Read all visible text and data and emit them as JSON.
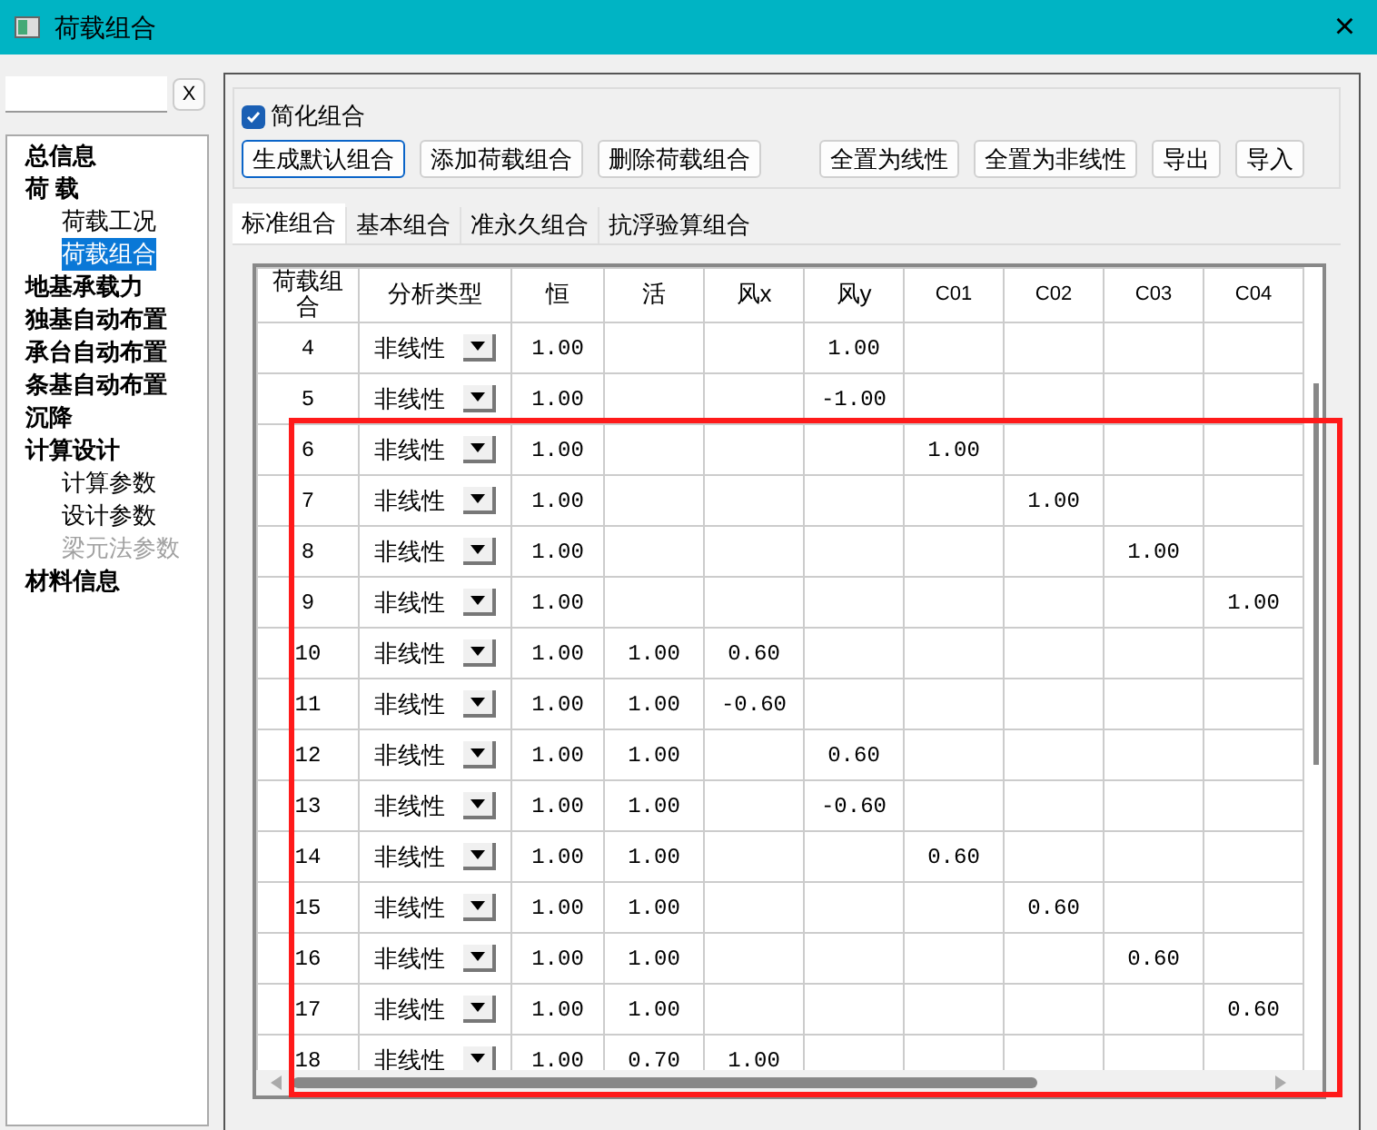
{
  "window": {
    "title": "荷载组合",
    "close": "×"
  },
  "search": {
    "clear": "X"
  },
  "tree": [
    {
      "label": "总信息",
      "disabled": false,
      "selected": false
    },
    {
      "label": "荷 载",
      "disabled": false,
      "selected": false,
      "children": [
        {
          "label": "荷载工况",
          "disabled": false,
          "selected": false
        },
        {
          "label": "荷载组合",
          "disabled": false,
          "selected": true
        }
      ]
    },
    {
      "label": "地基承载力",
      "disabled": false,
      "selected": false
    },
    {
      "label": "独基自动布置",
      "disabled": false,
      "selected": false
    },
    {
      "label": "承台自动布置",
      "disabled": false,
      "selected": false
    },
    {
      "label": "条基自动布置",
      "disabled": false,
      "selected": false
    },
    {
      "label": "沉降",
      "disabled": false,
      "selected": false
    },
    {
      "label": "计算设计",
      "disabled": false,
      "selected": false,
      "children": [
        {
          "label": "计算参数",
          "disabled": false,
          "selected": false
        },
        {
          "label": "设计参数",
          "disabled": false,
          "selected": false
        },
        {
          "label": "梁元法参数",
          "disabled": true,
          "selected": false
        }
      ]
    },
    {
      "label": "材料信息",
      "disabled": false,
      "selected": false
    }
  ],
  "simplify": {
    "label": "简化组合",
    "checked": true
  },
  "buttons": [
    {
      "label": "生成默认组合",
      "selected": true
    },
    {
      "label": "添加荷载组合",
      "selected": false
    },
    {
      "label": "删除荷载组合",
      "selected": false
    },
    {
      "label": "全置为线性",
      "selected": false
    },
    {
      "label": "全置为非线性",
      "selected": false
    },
    {
      "label": "导出",
      "selected": false
    },
    {
      "label": "导入",
      "selected": false
    }
  ],
  "tabs": [
    {
      "label": "标准组合",
      "selected": true
    },
    {
      "label": "基本组合",
      "selected": false
    },
    {
      "label": "准永久组合",
      "selected": false
    },
    {
      "label": "抗浮验算组合",
      "selected": false
    }
  ],
  "table": {
    "columns": [
      "荷载组合",
      "分析类型",
      "恒",
      "活",
      "风x",
      "风y",
      "C01",
      "C02",
      "C03",
      "C04"
    ],
    "rows": [
      {
        "cells": [
          "4",
          "非线性",
          "1.00",
          "",
          "",
          "1.00",
          "",
          "",
          "",
          ""
        ]
      },
      {
        "cells": [
          "5",
          "非线性",
          "1.00",
          "",
          "",
          "-1.00",
          "",
          "",
          "",
          ""
        ]
      },
      {
        "cells": [
          "6",
          "非线性",
          "1.00",
          "",
          "",
          "",
          "1.00",
          "",
          "",
          ""
        ]
      },
      {
        "cells": [
          "7",
          "非线性",
          "1.00",
          "",
          "",
          "",
          "",
          "1.00",
          "",
          ""
        ]
      },
      {
        "cells": [
          "8",
          "非线性",
          "1.00",
          "",
          "",
          "",
          "",
          "",
          "1.00",
          ""
        ]
      },
      {
        "cells": [
          "9",
          "非线性",
          "1.00",
          "",
          "",
          "",
          "",
          "",
          "",
          "1.00"
        ]
      },
      {
        "cells": [
          "10",
          "非线性",
          "1.00",
          "1.00",
          "0.60",
          "",
          "",
          "",
          "",
          ""
        ]
      },
      {
        "cells": [
          "11",
          "非线性",
          "1.00",
          "1.00",
          "-0.60",
          "",
          "",
          "",
          "",
          ""
        ]
      },
      {
        "cells": [
          "12",
          "非线性",
          "1.00",
          "1.00",
          "",
          "0.60",
          "",
          "",
          "",
          ""
        ]
      },
      {
        "cells": [
          "13",
          "非线性",
          "1.00",
          "1.00",
          "",
          "-0.60",
          "",
          "",
          "",
          ""
        ]
      },
      {
        "cells": [
          "14",
          "非线性",
          "1.00",
          "1.00",
          "",
          "",
          "0.60",
          "",
          "",
          ""
        ]
      },
      {
        "cells": [
          "15",
          "非线性",
          "1.00",
          "1.00",
          "",
          "",
          "",
          "0.60",
          "",
          ""
        ]
      },
      {
        "cells": [
          "16",
          "非线性",
          "1.00",
          "1.00",
          "",
          "",
          "",
          "",
          "0.60",
          ""
        ]
      },
      {
        "cells": [
          "17",
          "非线性",
          "1.00",
          "1.00",
          "",
          "",
          "",
          "",
          "",
          "0.60"
        ]
      },
      {
        "cells": [
          "18",
          "非线性",
          "1.00",
          "0.70",
          "1.00",
          "",
          "",
          "",
          "",
          ""
        ]
      }
    ]
  }
}
